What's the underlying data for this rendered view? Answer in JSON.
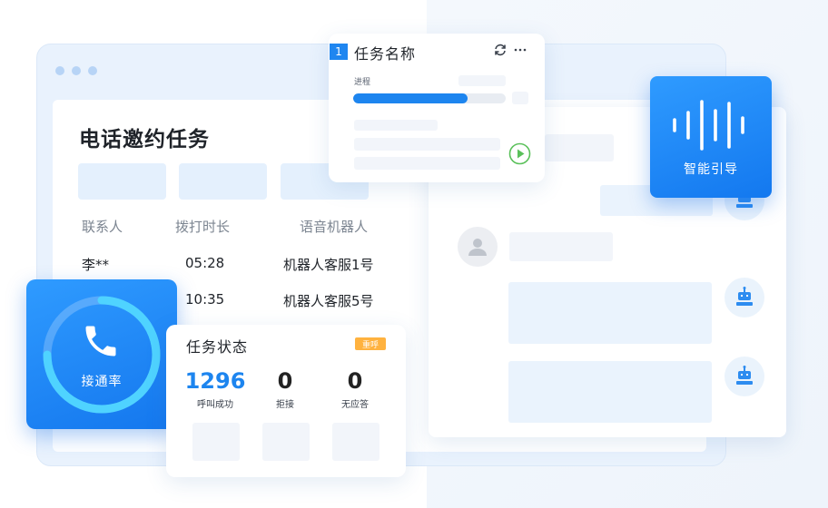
{
  "main": {
    "title": "电话邀约任务",
    "columns": [
      "联系人",
      "拨打时长",
      "语音机器人"
    ],
    "rows": [
      {
        "contact": "李**",
        "duration": "05:28",
        "robot": "机器人客服1号"
      },
      {
        "contact": "",
        "duration": "10:35",
        "robot": "机器人客服5号"
      }
    ]
  },
  "task_card": {
    "number": "1",
    "name": "任务名称",
    "progress_label": "进程",
    "progress_fraction": 0.75,
    "refresh_icon": "refresh-icon",
    "more_icon": "more-icon",
    "play_icon": "play-icon"
  },
  "voice_card": {
    "label": "智能引导",
    "icon": "waveform-icon"
  },
  "connect_card": {
    "label": "接通率",
    "icon": "phone-icon"
  },
  "status_card": {
    "title": "任务状态",
    "badge": "重呼",
    "metrics": [
      {
        "value": "1296",
        "label": "呼叫成功",
        "color": "#1d85ef"
      },
      {
        "value": "0",
        "label": "拒接",
        "color": "#222222"
      },
      {
        "value": "0",
        "label": "无应答",
        "color": "#222222"
      }
    ]
  },
  "colors": {
    "accent": "#1d85ef",
    "badge": "#ffb23f"
  }
}
